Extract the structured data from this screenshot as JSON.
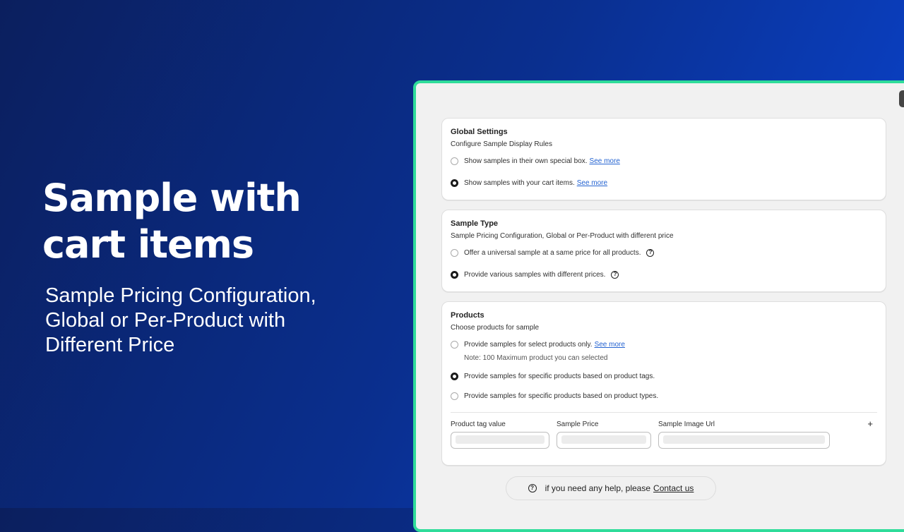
{
  "hero": {
    "title": "Sample with cart items",
    "subtitle": "Sample Pricing Configuration, Global or Per-Product with Different Price"
  },
  "global_settings": {
    "title": "Global Settings",
    "subtitle": "Configure Sample Display Rules",
    "options": [
      {
        "label": "Show samples in their own special box.",
        "link": "See more",
        "selected": false
      },
      {
        "label": "Show samples with your cart items.",
        "link": "See more",
        "selected": true
      }
    ]
  },
  "sample_type": {
    "title": "Sample Type",
    "subtitle": "Sample Pricing Configuration, Global or Per-Product with different price",
    "options": [
      {
        "label": "Offer a universal sample at a same price for all products.",
        "selected": false
      },
      {
        "label": "Provide various samples with different prices.",
        "selected": true
      }
    ]
  },
  "products": {
    "title": "Products",
    "subtitle": "Choose products for sample",
    "options": [
      {
        "label": "Provide samples for select products only.",
        "link": "See more",
        "selected": false
      },
      {
        "label": "Provide samples for specific products based on product tags.",
        "selected": true
      },
      {
        "label": "Provide samples for specific products based on product types.",
        "selected": false
      }
    ],
    "note": "Note: 100 Maximum product you can selected",
    "fields": {
      "tag_label": "Product tag value",
      "price_label": "Sample Price",
      "image_label": "Sample Image Url",
      "add": "+"
    }
  },
  "help": {
    "icon_glyph": "?",
    "text": "if you need any help, please",
    "link": "Contact us"
  },
  "colors": {
    "frame_border": "#2fdc9a",
    "link": "#2463d1"
  }
}
